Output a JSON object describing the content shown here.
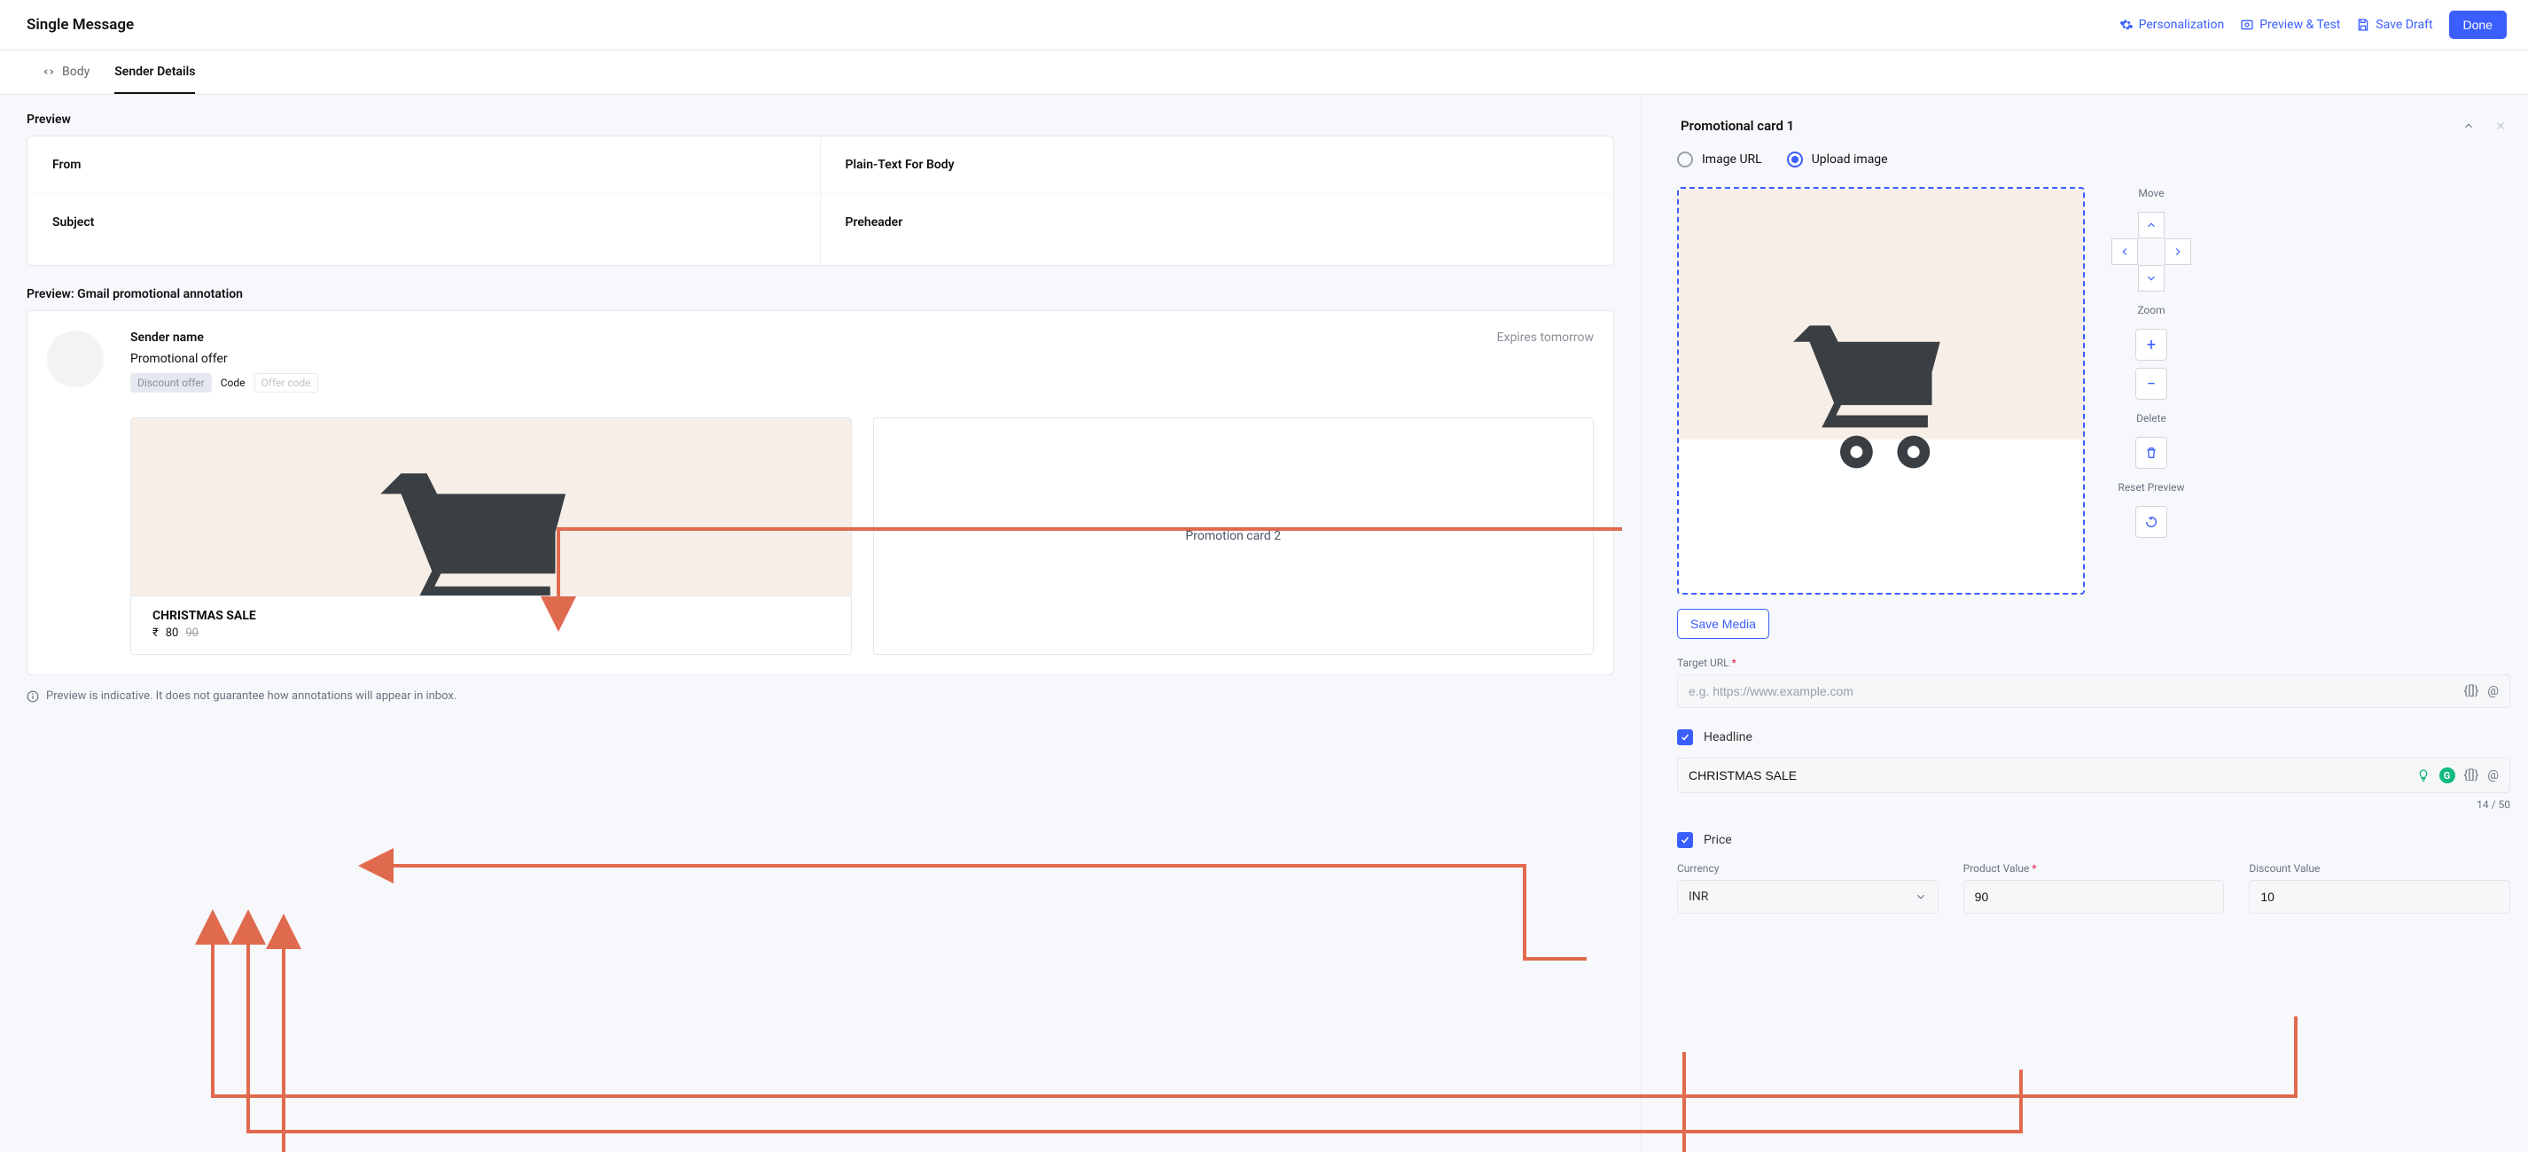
{
  "header": {
    "title": "Single Message",
    "personalization": "Personalization",
    "preview_test": "Preview & Test",
    "save_draft": "Save Draft",
    "done": "Done"
  },
  "tabs": {
    "body": "Body",
    "sender_details": "Sender Details"
  },
  "left": {
    "preview_heading": "Preview",
    "from_label": "From",
    "plain_text_label": "Plain-Text For Body",
    "subject_label": "Subject",
    "preheader_label": "Preheader",
    "gmail_heading": "Preview: Gmail promotional annotation",
    "sender_name": "Sender name",
    "expires": "Expires tomorrow",
    "promotional_offer": "Promotional offer",
    "discount_chip": "Discount offer",
    "code_label": "Code",
    "offer_code_chip": "Offer code",
    "card1_headline": "CHRISTMAS SALE",
    "card1_currency_sym": "₹",
    "card1_price": "80",
    "card1_old_price": "90",
    "card2_placeholder": "Promotion card 2",
    "note": "Preview is indicative. It does not guarantee how annotations will appear in inbox."
  },
  "right": {
    "acc_title": "Promotional card 1",
    "radio_image_url": "Image URL",
    "radio_upload": "Upload image",
    "move_label": "Move",
    "zoom_label": "Zoom",
    "delete_label": "Delete",
    "reset_label": "Reset Preview",
    "save_media": "Save Media",
    "target_url_label": "Target URL",
    "target_url_placeholder": "e.g. https://www.example.com",
    "headline_label": "Headline",
    "headline_value": "CHRISTMAS SALE",
    "headline_count": "14 / 50",
    "price_label": "Price",
    "currency_label": "Currency",
    "currency_value": "INR",
    "product_value_label": "Product Value",
    "product_value": "90",
    "discount_value_label": "Discount Value",
    "discount_value": "10"
  }
}
